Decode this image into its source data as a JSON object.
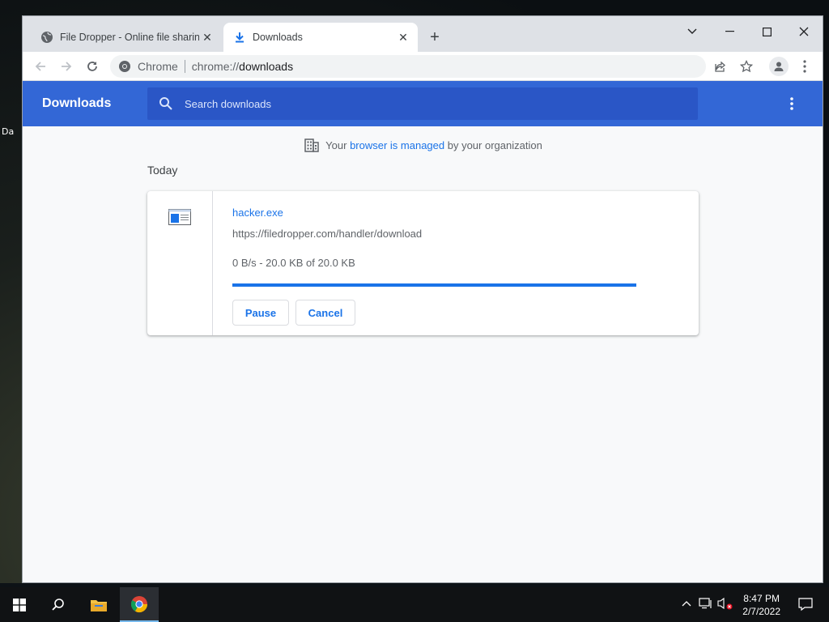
{
  "desktop": {
    "label": "Da"
  },
  "browser": {
    "tabs": [
      {
        "title": "File Dropper - Online file sharing",
        "icon": "globe-icon",
        "active": false
      },
      {
        "title": "Downloads",
        "icon": "download-icon",
        "active": true
      }
    ],
    "omnibox": {
      "chip": "Chrome",
      "url_scheme": "chrome://",
      "url_path": "downloads"
    }
  },
  "downloads_page": {
    "title": "Downloads",
    "search_placeholder": "Search downloads",
    "managed_notice": {
      "prefix": "Your ",
      "link": "browser is managed",
      "suffix": " by your organization"
    },
    "day_label": "Today",
    "items": [
      {
        "filename": "hacker.exe",
        "source_url": "https://filedropper.com/handler/download",
        "status": "0 B/s - 20.0 KB of 20.0 KB",
        "progress_fraction": 1.0,
        "buttons": [
          "Pause",
          "Cancel"
        ]
      }
    ]
  },
  "taskbar": {
    "time": "8:47 PM",
    "date": "2/7/2022"
  },
  "colors": {
    "header_blue": "#3367d6",
    "link_blue": "#1a73e8",
    "search_bg": "#2a56c6"
  }
}
